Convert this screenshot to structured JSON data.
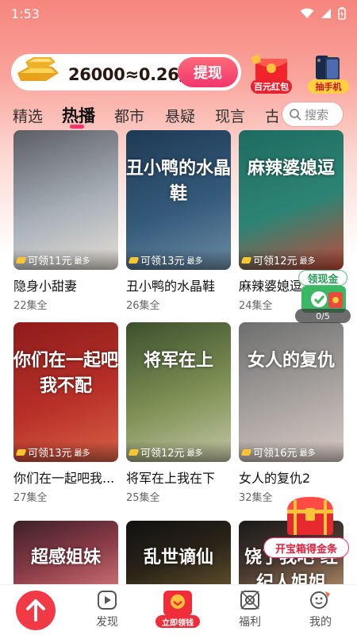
{
  "status_bar": {
    "time": "1:53"
  },
  "coin_banner": {
    "text": "26000≈0.26元",
    "withdraw_label": "提现"
  },
  "promos": [
    {
      "label": "百元红包",
      "icon": "red-envelope-icon"
    },
    {
      "label": "抽手机",
      "icon": "phone-icon"
    }
  ],
  "tabs": [
    "精选",
    "热播",
    "都市",
    "悬疑",
    "现言",
    "古"
  ],
  "active_tab": "热播",
  "search": {
    "placeholder": "搜索"
  },
  "dramas": [
    {
      "title": "隐身小甜妻",
      "episodes": "22集全",
      "reward": "可领11元",
      "max": "最多",
      "poster_text": "",
      "colors": [
        "#5b5d63",
        "#a8b0b8",
        "#e6dfd6"
      ]
    },
    {
      "title": "丑小鸭的水晶鞋",
      "episodes": "26集全",
      "reward": "可领13元",
      "max": "最多",
      "poster_text": "丑小鸭的水晶鞋",
      "colors": [
        "#1e3a55",
        "#345a7a",
        "#6d8ca6"
      ]
    },
    {
      "title": "麻辣婆媳逗",
      "episodes": "24集全",
      "reward": "可领12元",
      "max": "最多",
      "poster_text": "麻辣婆媳逗",
      "colors": [
        "#1d6c61",
        "#2d8474",
        "#c14a3a"
      ]
    },
    {
      "title": "你们在一起吧我...",
      "episodes": "27集全",
      "reward": "可领13元",
      "max": "最多",
      "poster_text": "你们在一起吧 我不配",
      "colors": [
        "#8e1c1b",
        "#b83028",
        "#d86147"
      ]
    },
    {
      "title": "将军在上我在下",
      "episodes": "25集全",
      "reward": "可领12元",
      "max": "最多",
      "poster_text": "将军在上",
      "colors": [
        "#3c4f2d",
        "#7f9256",
        "#c5c6a6"
      ]
    },
    {
      "title": "女人的复仇2",
      "episodes": "32集全",
      "reward": "可领16元",
      "max": "最多",
      "poster_text": "女人的复仇",
      "colors": [
        "#6d6e6e",
        "#a8a3a0",
        "#d9cbc2"
      ]
    },
    {
      "title": "",
      "episodes": "",
      "reward": "",
      "max": "",
      "poster_text": "超感姐妹",
      "colors": [
        "#3c2128",
        "#8a3b47",
        "#c56b6f"
      ]
    },
    {
      "title": "",
      "episodes": "",
      "reward": "",
      "max": "",
      "poster_text": "乱世谪仙",
      "colors": [
        "#111",
        "#2a2418",
        "#5a4a2a"
      ]
    },
    {
      "title": "",
      "episodes": "",
      "reward": "",
      "max": "",
      "poster_text": "饶了我吧 经纪人姐姐",
      "colors": [
        "#1a1a1a",
        "#4a3a30",
        "#a28060"
      ]
    }
  ],
  "float_gold": {
    "label": "领现金",
    "progress": "0/5"
  },
  "treasure": {
    "label": "开宝箱得金条"
  },
  "bottom_nav": {
    "items": [
      {
        "label": "发现",
        "icon": "play-icon"
      },
      {
        "label": "立即领钱",
        "icon": "gift-coin-icon"
      },
      {
        "label": "福利",
        "icon": "welfare-icon"
      },
      {
        "label": "我的",
        "icon": "profile-icon"
      }
    ]
  },
  "colors": {
    "accent": "#f2366b",
    "nav_red": "#f23a47"
  }
}
